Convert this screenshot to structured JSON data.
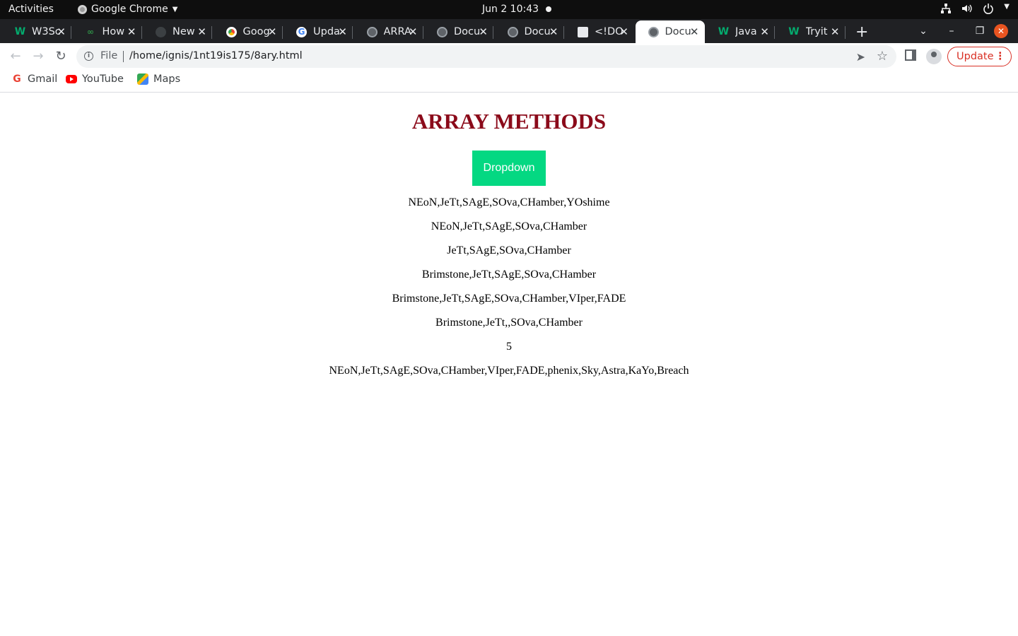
{
  "system_bar": {
    "activities": "Activities",
    "app_name": "Google Chrome",
    "clock": "Jun 2  10:43"
  },
  "tabs": [
    {
      "title": "W3Sc",
      "icon": "w3schools-icon"
    },
    {
      "title": "How",
      "icon": "gfg-icon"
    },
    {
      "title": "New",
      "icon": "dark-circle-icon"
    },
    {
      "title": "Goog",
      "icon": "chrome-icon"
    },
    {
      "title": "Upda",
      "icon": "google-icon"
    },
    {
      "title": "ARRA",
      "icon": "globe-icon"
    },
    {
      "title": "Docu",
      "icon": "globe-icon"
    },
    {
      "title": "Docu",
      "icon": "globe-icon"
    },
    {
      "title": "<!DO",
      "icon": "qr-icon"
    },
    {
      "title": "Docu",
      "icon": "globe-icon",
      "active": true
    },
    {
      "title": "Java",
      "icon": "w3schools-icon"
    },
    {
      "title": "Tryit",
      "icon": "w3schools-icon"
    }
  ],
  "omnibox": {
    "scheme": "File",
    "url": "/home/ignis/1nt19is175/8ary.html"
  },
  "toolbar": {
    "update_label": "Update"
  },
  "bookmarks": [
    {
      "label": "Gmail",
      "icon": "gmail-icon"
    },
    {
      "label": "YouTube",
      "icon": "youtube-icon"
    },
    {
      "label": "Maps",
      "icon": "maps-icon"
    }
  ],
  "page": {
    "heading": "ARRAY METHODS",
    "dropdown_label": "Dropdown",
    "heading_color": "#8b0a1a",
    "button_color": "#04d882",
    "output_lines": [
      "NEoN,JeTt,SAgE,SOva,CHamber,YOshime",
      "NEoN,JeTt,SAgE,SOva,CHamber",
      "JeTt,SAgE,SOva,CHamber",
      "Brimstone,JeTt,SAgE,SOva,CHamber",
      "Brimstone,JeTt,SAgE,SOva,CHamber,VIper,FADE",
      "Brimstone,JeTt,,SOva,CHamber",
      "5",
      "NEoN,JeTt,SAgE,SOva,CHamber,VIper,FADE,phenix,Sky,Astra,KaYo,Breach"
    ]
  }
}
